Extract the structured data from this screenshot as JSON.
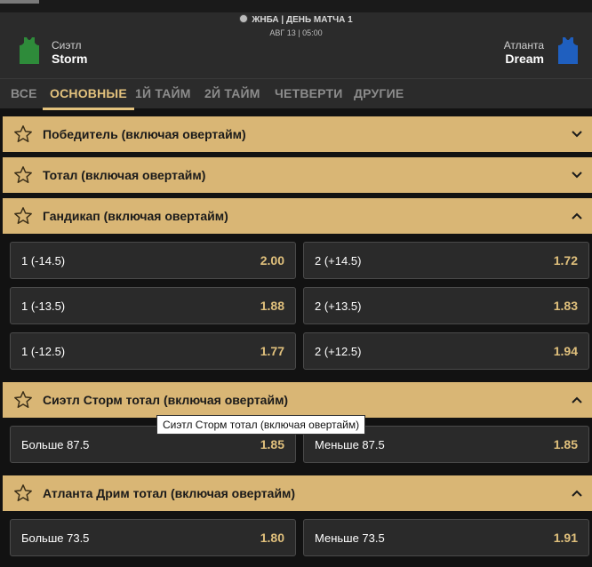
{
  "header": {
    "league": "ЖНБА |  ДЕНЬ МАТЧА  1",
    "datetime": "АВГ 13 | 05:00",
    "home": {
      "city": "Сиэтл",
      "name": "Storm",
      "jersey_color": "#2e8b3a"
    },
    "away": {
      "city": "Атланта",
      "name": "Dream",
      "jersey_color": "#1f5fbf"
    }
  },
  "tabs": [
    {
      "label": "ВСЕ",
      "active": false
    },
    {
      "label": "ОСНОВНЫЕ",
      "active": true
    },
    {
      "label": "1Й ТАЙМ",
      "active": false
    },
    {
      "label": "2Й ТАЙМ",
      "active": false
    },
    {
      "label": "ЧЕТВЕРТИ",
      "active": false
    },
    {
      "label": "ДРУГИЕ",
      "active": false
    }
  ],
  "markets": [
    {
      "title": "Победитель (включая овертайм)",
      "expanded": false
    },
    {
      "title": "Тотал (включая овертайм)",
      "expanded": false
    },
    {
      "title": "Гандикап (включая овертайм)",
      "expanded": true,
      "rows": [
        [
          {
            "label": "1 (-14.5)",
            "value": "2.00"
          },
          {
            "label": "2 (+14.5)",
            "value": "1.72"
          }
        ],
        [
          {
            "label": "1 (-13.5)",
            "value": "1.88"
          },
          {
            "label": "2 (+13.5)",
            "value": "1.83"
          }
        ],
        [
          {
            "label": "1 (-12.5)",
            "value": "1.77"
          },
          {
            "label": "2 (+12.5)",
            "value": "1.94"
          }
        ]
      ]
    },
    {
      "title": "Сиэтл Сторм тотал (включая овертайм)",
      "expanded": true,
      "rows": [
        [
          {
            "label": "Больше 87.5",
            "value": "1.85"
          },
          {
            "label": "Меньше 87.5",
            "value": "1.85"
          }
        ]
      ]
    },
    {
      "title": "Атланта Дрим тотал (включая овертайм)",
      "expanded": true,
      "rows": [
        [
          {
            "label": "Больше 73.5",
            "value": "1.80"
          },
          {
            "label": "Меньше 73.5",
            "value": "1.91"
          }
        ]
      ]
    }
  ],
  "tooltip": "Сиэтл Сторм тотал (включая овертайм)",
  "colors": {
    "accent": "#e3c27d",
    "market_bar": "#d9b675",
    "odd_value": "#e0c07c"
  },
  "icons": {
    "star": "star-icon",
    "chevron_down": "chevron-down-icon",
    "chevron_up": "chevron-up-icon",
    "ball": "basketball-icon",
    "jersey": "jersey-icon"
  }
}
